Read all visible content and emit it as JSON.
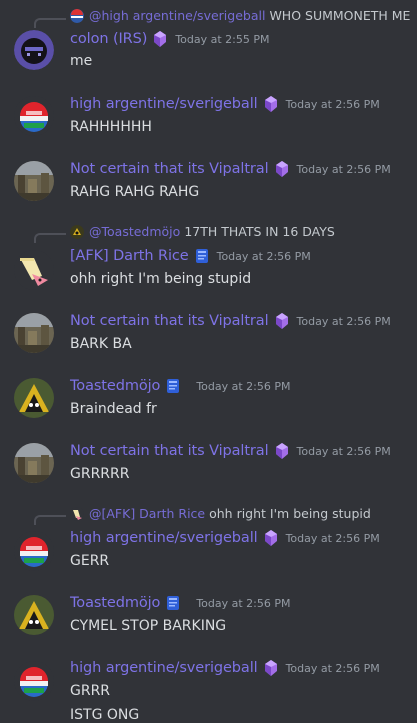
{
  "messages": [
    {
      "reply": {
        "name": "@high argentine/sverigeball",
        "text": "WHO SUMMONETH ME"
      },
      "author": "colon (IRS)",
      "time": "Today at 2:55 PM",
      "lines": [
        "me"
      ]
    },
    {
      "author": "high argentine/sverigeball",
      "time": "Today at 2:56 PM",
      "lines": [
        "RAHHHHHH"
      ]
    },
    {
      "author": "Not certain that its Vipaltral",
      "time": "Today at 2:56 PM",
      "lines": [
        "RAHG RAHG RAHG"
      ]
    },
    {
      "reply": {
        "name": "@Toastedmöjo",
        "text": "17TH THATS IN 16 DAYS"
      },
      "author": "[AFK] Darth Rice",
      "time": "Today at 2:56 PM",
      "lines": [
        "ohh right I'm being stupid"
      ]
    },
    {
      "author": "Not certain that its Vipaltral",
      "time": "Today at 2:56 PM",
      "lines": [
        "BARK BA"
      ]
    },
    {
      "author": "Toastedmöjo",
      "time": "Today at 2:56 PM",
      "lines": [
        "Braindead fr"
      ]
    },
    {
      "author": "Not certain that its Vipaltral",
      "time": "Today at 2:56 PM",
      "lines": [
        "GRRRRR"
      ]
    },
    {
      "reply": {
        "name": "@[AFK] Darth Rice",
        "text": "ohh right I'm being stupid"
      },
      "author": "high argentine/sverigeball",
      "time": "Today at 2:56 PM",
      "lines": [
        "GERR"
      ]
    },
    {
      "author": "Toastedmöjo",
      "time": "Today at 2:56 PM",
      "lines": [
        "CYMEL STOP BARKING"
      ]
    },
    {
      "author": "high argentine/sverigeball",
      "time": "Today at 2:56 PM",
      "lines": [
        "GRRR",
        "ISTG ONG"
      ]
    }
  ],
  "colors": {
    "background": "#313338",
    "username": "#7e73e6",
    "timestamp": "#949ba4",
    "text": "#dbdee1"
  },
  "icons": {
    "nitro_badge": "purple-crystal-icon",
    "booster_badge": "blue-book-icon"
  }
}
